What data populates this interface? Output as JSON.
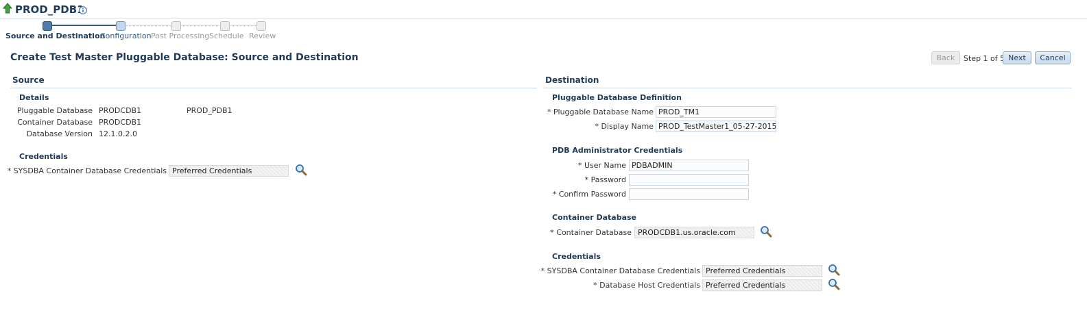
{
  "header": {
    "title": "PROD_PDB1"
  },
  "train": {
    "steps": [
      {
        "label": "Source and Destination",
        "state": "current"
      },
      {
        "label": "Configuration",
        "state": "next"
      },
      {
        "label": "Post Processing",
        "state": "todo"
      },
      {
        "label": "Schedule",
        "state": "todo"
      },
      {
        "label": "Review",
        "state": "todo"
      }
    ]
  },
  "wizard": {
    "title": "Create Test Master Pluggable Database: Source and Destination",
    "back_label": "Back",
    "step_text": "Step 1 of 5",
    "next_label": "Next",
    "cancel_label": "Cancel"
  },
  "source": {
    "heading": "Source",
    "details": {
      "heading": "Details",
      "pdb_label": "Pluggable Database",
      "pdb_value": "PRODCDB1",
      "pdb_value2": "PROD_PDB1",
      "cdb_label": "Container Database",
      "cdb_value": "PRODCDB1",
      "version_label": "Database Version",
      "version_value": "12.1.0.2.0"
    },
    "credentials": {
      "heading": "Credentials",
      "sysdba_label": "* SYSDBA Container Database Credentials",
      "sysdba_value": "Preferred Credentials"
    }
  },
  "destination": {
    "heading": "Destination",
    "pdb_def": {
      "heading": "Pluggable Database Definition",
      "name_label": "* Pluggable Database Name",
      "name_value": "PROD_TM1",
      "display_label": "* Display Name",
      "display_value": "PROD_TestMaster1_05-27-2015"
    },
    "admin": {
      "heading": "PDB Administrator Credentials",
      "user_label": "* User Name",
      "user_value": "PDBADMIN",
      "password_label": "* Password",
      "password_value": "",
      "confirm_label": "* Confirm Password",
      "confirm_value": ""
    },
    "container": {
      "heading": "Container Database",
      "cdb_label": "* Container Database",
      "cdb_value": "PRODCDB1.us.oracle.com"
    },
    "credentials": {
      "heading": "Credentials",
      "sysdba_label": "* SYSDBA Container Database Credentials",
      "sysdba_value": "Preferred Credentials",
      "host_label": "* Database Host Credentials",
      "host_value": "Preferred Credentials"
    }
  },
  "colors": {
    "accent": "#1f3b57",
    "train_active": "#4f7ca8",
    "rule": "#c9d7e4"
  }
}
